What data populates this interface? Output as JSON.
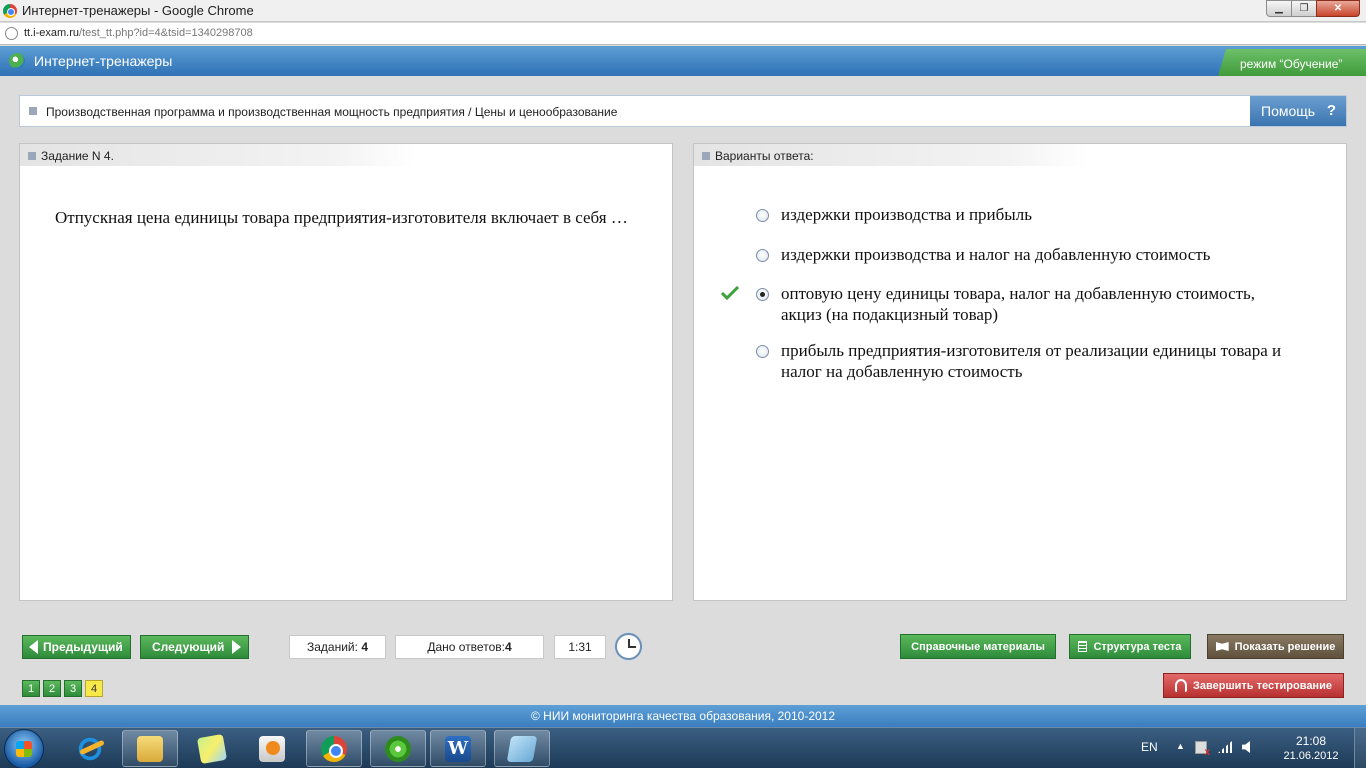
{
  "window": {
    "title": "Интернет-тренажеры - Google Chrome",
    "minimize": "▁",
    "maximize": "❐",
    "close": "✕"
  },
  "address": {
    "host": "tt.i-exam.ru",
    "path": "/test_tt.php?id=4&tsid=1340298708"
  },
  "app": {
    "title": "Интернет-тренажеры",
    "mode": "режим “Обучение”"
  },
  "breadcrumb": "Производственная программа и производственная мощность предприятия / Цены и ценообразование",
  "help": {
    "label": "Помощь",
    "icon": "?"
  },
  "task": {
    "header": "Задание N 4.",
    "question": "Отпускная цена единицы товара предприятия-изготовителя включает в себя …"
  },
  "answers": {
    "header": "Варианты ответа:",
    "options": [
      {
        "text": "издержки производства и прибыль",
        "selected": false
      },
      {
        "text": "издержки производства и налог на добавленную стоимость",
        "selected": false
      },
      {
        "text": "оптовую цену единицы товара, налог на добавленную стоимость, акциз (на подакцизный товар)",
        "selected": true,
        "correct": true
      },
      {
        "text": "прибыль предприятия-изготовителя от реализации единицы товара и налог на добавленную стоимость",
        "selected": false
      }
    ]
  },
  "toolbar": {
    "prev": "Предыдущий",
    "next": "Следующий",
    "tasks_label": "Заданий:",
    "tasks_value": "4",
    "answers_label": "Дано ответов:",
    "answers_value": "4",
    "timer": "1:31",
    "reference": "Справочные материалы",
    "structure": "Структура теста",
    "show_solution": "Показать решение",
    "finish": "Завершить тестирование"
  },
  "pages": [
    "1",
    "2",
    "3",
    "4"
  ],
  "current_page": "4",
  "footer": "© НИИ мониторинга качества образования, 2010-2012",
  "taskbar": {
    "items": [
      "internet-explorer-icon",
      "folder-icon",
      "sticky-notes-icon",
      "media-player-icon",
      "chrome-icon",
      "icq-icon",
      "word-icon",
      "notepad-icon"
    ],
    "word_letter": "W",
    "lang": "EN",
    "tray_arrow": "▲",
    "time": "21:08",
    "date": "21.06.2012"
  },
  "colors": {
    "accent_blue": "#2e71b5",
    "button_green": "#2e8b3a",
    "finish_red": "#b83030",
    "current_page_yellow": "#f7e94a"
  }
}
